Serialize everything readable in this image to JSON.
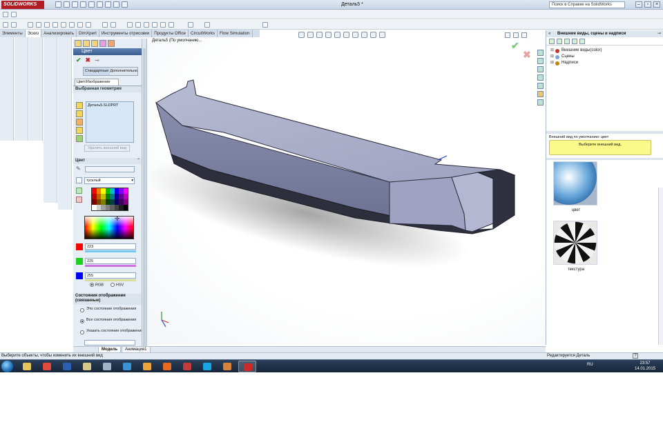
{
  "app": {
    "logo": "SOLIDWORKS",
    "document_title": "Деталь5 *",
    "help_search_placeholder": "Поиск в Справке на SolidWorks"
  },
  "command_tabs": [
    "Элементы",
    "Эскиз",
    "Анализировать",
    "DimXpert",
    "Инструменты отрисовки",
    "Продукты Office",
    "CircuitWorks",
    "Flow Simulation"
  ],
  "active_tab_index": 1,
  "graphics": {
    "tree_label": "Деталь5  (По умолчанию..."
  },
  "property_manager": {
    "title": "Цвет",
    "help": "?",
    "mode_buttons": [
      "Стандартные",
      "Дополнительно"
    ],
    "subtab": "Цвет/Изображение",
    "selected_geometry": {
      "title": "Выбранная геометрия",
      "items": [
        "Деталь5.SLDPRT"
      ],
      "delete_button": "Удалить внешний вид"
    },
    "color": {
      "title": "Цвет",
      "finish": "тусклый",
      "channels": [
        {
          "name": "R",
          "value": "223",
          "swatch": "#ff0000",
          "bar": "#72c8f0"
        },
        {
          "name": "G",
          "value": "225",
          "swatch": "#20d020",
          "bar": "#d06fe0"
        },
        {
          "name": "B",
          "value": "255",
          "swatch": "#0000ff",
          "bar": "#d8dc9a"
        }
      ],
      "mode_rgb": "RGB",
      "mode_hsv": "HSV",
      "mode_selected": "RGB"
    },
    "display_states": {
      "title": "Состояния отображения (связанные)",
      "options": [
        "Это состояние отображения",
        "Все состояния отображения",
        "Указать состояние отображения"
      ],
      "selected_index": 1
    }
  },
  "task_pane": {
    "title": "Внешние виды, сцены и надписи",
    "tree": [
      {
        "label": "Внешние виды(color)",
        "icon_color": "#c0392b"
      },
      {
        "label": "Сцены",
        "icon_color": "#7aa7d8"
      },
      {
        "label": "Надписи",
        "icon_color": "#b8860b"
      }
    ],
    "default_appearance_label": "Внешний вид по умолчанию: цвет",
    "select_prompt": "Выберите внешний вид.",
    "thumbnails": [
      {
        "label": "цвет",
        "kind": "sphere-blue"
      },
      {
        "label": "текстура",
        "kind": "sphere-tex"
      }
    ]
  },
  "bottom_tabs": [
    "Модель",
    "Анимация1"
  ],
  "active_bottom_tab": 0,
  "status_bar": {
    "hint": "Выберите объекты, чтобы изменить их внешний вид",
    "editing": "Редактируется Деталь",
    "help_icon": "?"
  },
  "taskbar": {
    "language": "RU",
    "time": "23:57",
    "date": "14.01.2015",
    "apps": [
      {
        "name": "explorer",
        "color": "#e8c25a"
      },
      {
        "name": "chrome",
        "color": "#e04a3a"
      },
      {
        "name": "word",
        "color": "#2b5fb2"
      },
      {
        "name": "paint",
        "color": "#d7c98a"
      },
      {
        "name": "calculator",
        "color": "#9fb4c8"
      },
      {
        "name": "ie",
        "color": "#3a93d6"
      },
      {
        "name": "media",
        "color": "#f0a33a"
      },
      {
        "name": "firefox",
        "color": "#e86a1e"
      },
      {
        "name": "app-red",
        "color": "#c23a3a"
      },
      {
        "name": "skype",
        "color": "#1aa3e8"
      },
      {
        "name": "chrome2",
        "color": "#d8823a"
      },
      {
        "name": "solidworks",
        "color": "#d02828"
      }
    ]
  }
}
